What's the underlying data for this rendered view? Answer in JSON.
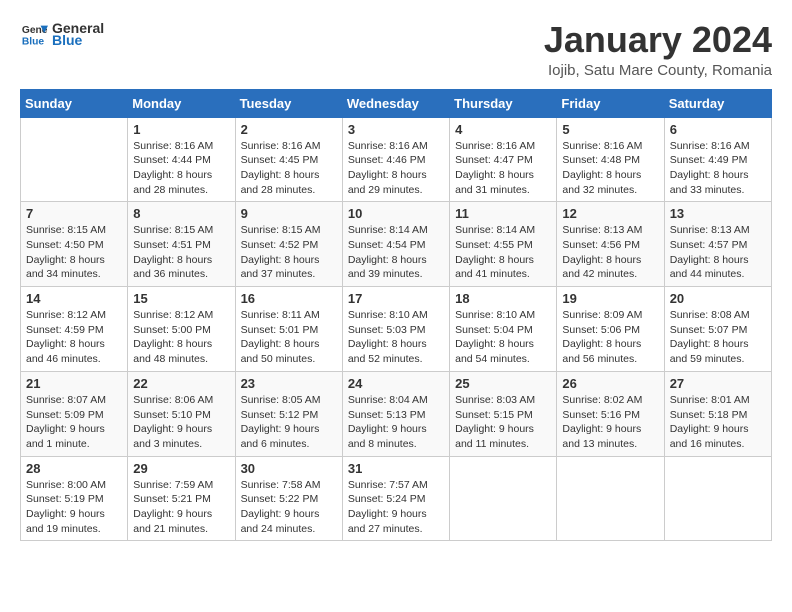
{
  "logo": {
    "text_general": "General",
    "text_blue": "Blue"
  },
  "title": "January 2024",
  "subtitle": "Iojib, Satu Mare County, Romania",
  "days_header": [
    "Sunday",
    "Monday",
    "Tuesday",
    "Wednesday",
    "Thursday",
    "Friday",
    "Saturday"
  ],
  "weeks": [
    [
      {
        "day": "",
        "info": ""
      },
      {
        "day": "1",
        "info": "Sunrise: 8:16 AM\nSunset: 4:44 PM\nDaylight: 8 hours\nand 28 minutes."
      },
      {
        "day": "2",
        "info": "Sunrise: 8:16 AM\nSunset: 4:45 PM\nDaylight: 8 hours\nand 28 minutes."
      },
      {
        "day": "3",
        "info": "Sunrise: 8:16 AM\nSunset: 4:46 PM\nDaylight: 8 hours\nand 29 minutes."
      },
      {
        "day": "4",
        "info": "Sunrise: 8:16 AM\nSunset: 4:47 PM\nDaylight: 8 hours\nand 31 minutes."
      },
      {
        "day": "5",
        "info": "Sunrise: 8:16 AM\nSunset: 4:48 PM\nDaylight: 8 hours\nand 32 minutes."
      },
      {
        "day": "6",
        "info": "Sunrise: 8:16 AM\nSunset: 4:49 PM\nDaylight: 8 hours\nand 33 minutes."
      }
    ],
    [
      {
        "day": "7",
        "info": "Sunrise: 8:15 AM\nSunset: 4:50 PM\nDaylight: 8 hours\nand 34 minutes."
      },
      {
        "day": "8",
        "info": "Sunrise: 8:15 AM\nSunset: 4:51 PM\nDaylight: 8 hours\nand 36 minutes."
      },
      {
        "day": "9",
        "info": "Sunrise: 8:15 AM\nSunset: 4:52 PM\nDaylight: 8 hours\nand 37 minutes."
      },
      {
        "day": "10",
        "info": "Sunrise: 8:14 AM\nSunset: 4:54 PM\nDaylight: 8 hours\nand 39 minutes."
      },
      {
        "day": "11",
        "info": "Sunrise: 8:14 AM\nSunset: 4:55 PM\nDaylight: 8 hours\nand 41 minutes."
      },
      {
        "day": "12",
        "info": "Sunrise: 8:13 AM\nSunset: 4:56 PM\nDaylight: 8 hours\nand 42 minutes."
      },
      {
        "day": "13",
        "info": "Sunrise: 8:13 AM\nSunset: 4:57 PM\nDaylight: 8 hours\nand 44 minutes."
      }
    ],
    [
      {
        "day": "14",
        "info": "Sunrise: 8:12 AM\nSunset: 4:59 PM\nDaylight: 8 hours\nand 46 minutes."
      },
      {
        "day": "15",
        "info": "Sunrise: 8:12 AM\nSunset: 5:00 PM\nDaylight: 8 hours\nand 48 minutes."
      },
      {
        "day": "16",
        "info": "Sunrise: 8:11 AM\nSunset: 5:01 PM\nDaylight: 8 hours\nand 50 minutes."
      },
      {
        "day": "17",
        "info": "Sunrise: 8:10 AM\nSunset: 5:03 PM\nDaylight: 8 hours\nand 52 minutes."
      },
      {
        "day": "18",
        "info": "Sunrise: 8:10 AM\nSunset: 5:04 PM\nDaylight: 8 hours\nand 54 minutes."
      },
      {
        "day": "19",
        "info": "Sunrise: 8:09 AM\nSunset: 5:06 PM\nDaylight: 8 hours\nand 56 minutes."
      },
      {
        "day": "20",
        "info": "Sunrise: 8:08 AM\nSunset: 5:07 PM\nDaylight: 8 hours\nand 59 minutes."
      }
    ],
    [
      {
        "day": "21",
        "info": "Sunrise: 8:07 AM\nSunset: 5:09 PM\nDaylight: 9 hours\nand 1 minute."
      },
      {
        "day": "22",
        "info": "Sunrise: 8:06 AM\nSunset: 5:10 PM\nDaylight: 9 hours\nand 3 minutes."
      },
      {
        "day": "23",
        "info": "Sunrise: 8:05 AM\nSunset: 5:12 PM\nDaylight: 9 hours\nand 6 minutes."
      },
      {
        "day": "24",
        "info": "Sunrise: 8:04 AM\nSunset: 5:13 PM\nDaylight: 9 hours\nand 8 minutes."
      },
      {
        "day": "25",
        "info": "Sunrise: 8:03 AM\nSunset: 5:15 PM\nDaylight: 9 hours\nand 11 minutes."
      },
      {
        "day": "26",
        "info": "Sunrise: 8:02 AM\nSunset: 5:16 PM\nDaylight: 9 hours\nand 13 minutes."
      },
      {
        "day": "27",
        "info": "Sunrise: 8:01 AM\nSunset: 5:18 PM\nDaylight: 9 hours\nand 16 minutes."
      }
    ],
    [
      {
        "day": "28",
        "info": "Sunrise: 8:00 AM\nSunset: 5:19 PM\nDaylight: 9 hours\nand 19 minutes."
      },
      {
        "day": "29",
        "info": "Sunrise: 7:59 AM\nSunset: 5:21 PM\nDaylight: 9 hours\nand 21 minutes."
      },
      {
        "day": "30",
        "info": "Sunrise: 7:58 AM\nSunset: 5:22 PM\nDaylight: 9 hours\nand 24 minutes."
      },
      {
        "day": "31",
        "info": "Sunrise: 7:57 AM\nSunset: 5:24 PM\nDaylight: 9 hours\nand 27 minutes."
      },
      {
        "day": "",
        "info": ""
      },
      {
        "day": "",
        "info": ""
      },
      {
        "day": "",
        "info": ""
      }
    ]
  ]
}
